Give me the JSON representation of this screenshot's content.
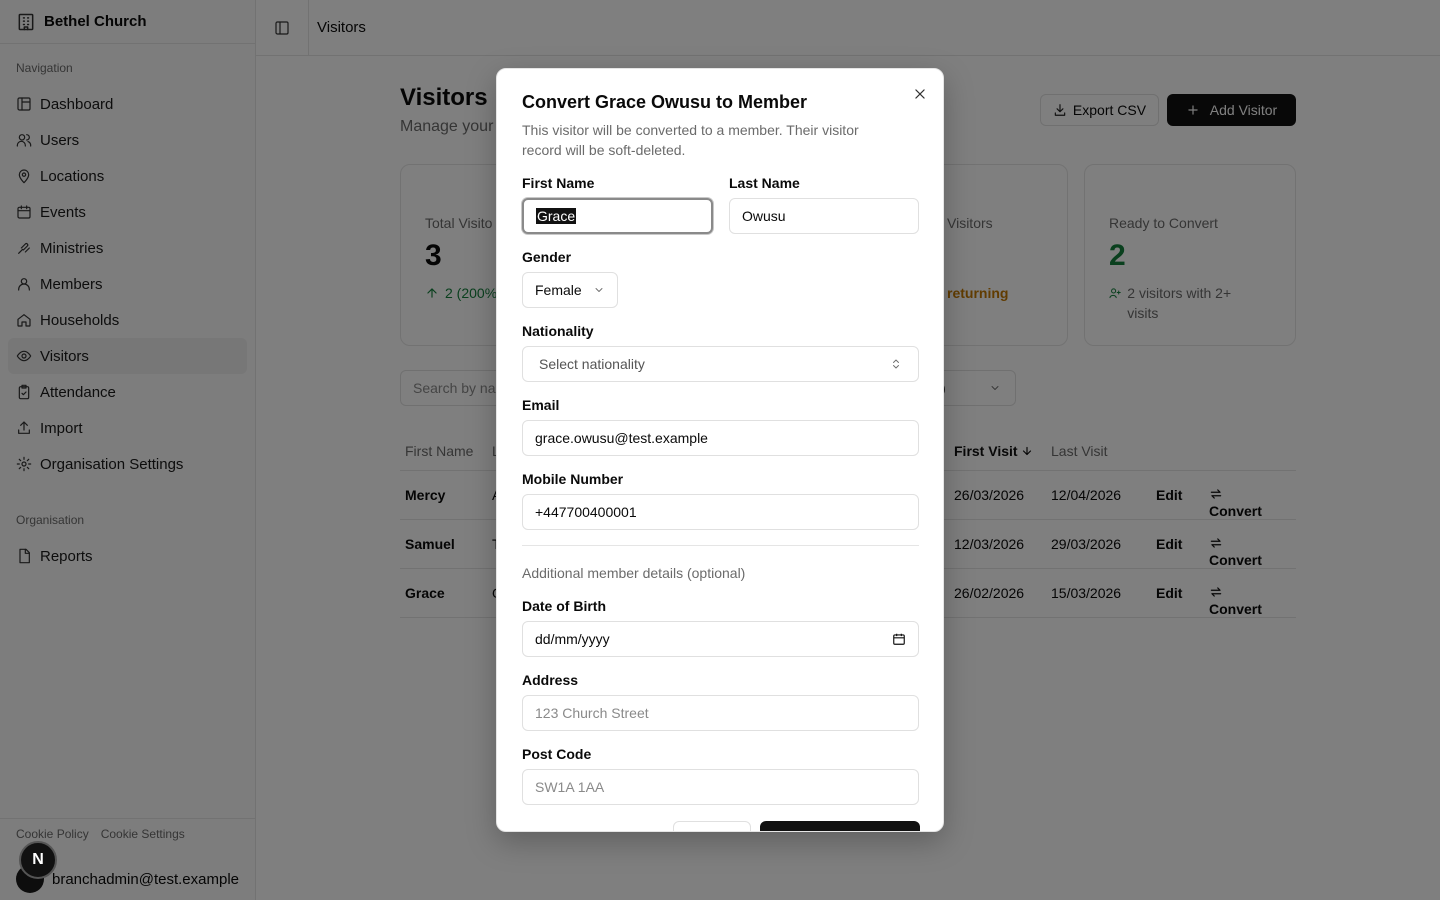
{
  "sidebar": {
    "org_name": "Bethel Church",
    "nav_group_label": "Navigation",
    "items": [
      {
        "label": "Dashboard",
        "icon": "dashboard-icon"
      },
      {
        "label": "Users",
        "icon": "users-icon"
      },
      {
        "label": "Locations",
        "icon": "map-pin-icon"
      },
      {
        "label": "Events",
        "icon": "calendar-icon"
      },
      {
        "label": "Ministries",
        "icon": "hands-icon"
      },
      {
        "label": "Members",
        "icon": "user-icon"
      },
      {
        "label": "Households",
        "icon": "home-icon"
      },
      {
        "label": "Visitors",
        "icon": "eye-icon",
        "active": true
      },
      {
        "label": "Attendance",
        "icon": "clipboard-icon"
      },
      {
        "label": "Import",
        "icon": "upload-icon"
      },
      {
        "label": "Organisation Settings",
        "icon": "gear-icon"
      }
    ],
    "org_group_label": "Organisation",
    "org_items": [
      {
        "label": "Reports",
        "icon": "file-icon"
      }
    ],
    "footer_links": [
      "Cookie Policy",
      "Cookie Settings"
    ],
    "user_email": "branchadmin@test.example",
    "next_badge": "N"
  },
  "topbar": {
    "title": "Visitors"
  },
  "page": {
    "title": "Visitors",
    "subtitle": "Manage your",
    "export_label": "Export CSV",
    "add_label": "Add Visitor",
    "search_placeholder": "Search by na",
    "filter_value": ")"
  },
  "stats": [
    {
      "label": "Total Visito",
      "value": "3",
      "note": "2 (200%)",
      "note_color": "#15803d"
    },
    {
      "label": "Visitors",
      "value": "",
      "note": "returning",
      "note_color": "#c27803"
    },
    {
      "label": "Ready to Convert",
      "value": "2",
      "note": "2 visitors with 2+ visits",
      "value_color": "#15803d"
    }
  ],
  "table": {
    "headers": {
      "first_name": "First Name",
      "last_name": "L",
      "first_visit": "First Visit",
      "last_visit": "Last Visit"
    },
    "rows": [
      {
        "first_name": "Mercy",
        "last_initial": "A",
        "first_visit": "26/03/2026",
        "last_visit": "12/04/2026"
      },
      {
        "first_name": "Samuel",
        "last_initial": "T",
        "first_visit": "12/03/2026",
        "last_visit": "29/03/2026"
      },
      {
        "first_name": "Grace",
        "last_initial": "O",
        "first_visit": "26/02/2026",
        "last_visit": "15/03/2026"
      }
    ],
    "edit_label": "Edit",
    "convert_label": "Convert"
  },
  "modal": {
    "title": "Convert Grace Owusu to Member",
    "description": "This visitor will be converted to a member. Their visitor record will be soft-deleted.",
    "first_name_label": "First Name",
    "first_name_value": "Grace",
    "last_name_label": "Last Name",
    "last_name_value": "Owusu",
    "gender_label": "Gender",
    "gender_value": "Female",
    "nationality_label": "Nationality",
    "nationality_placeholder": "Select nationality",
    "email_label": "Email",
    "email_value": "grace.owusu@test.example",
    "mobile_label": "Mobile Number",
    "mobile_value": "+447700400001",
    "additional_note": "Additional member details (optional)",
    "dob_label": "Date of Birth",
    "dob_placeholder": "dd/mm/yyyy",
    "address_label": "Address",
    "address_placeholder": "123 Church Street",
    "postcode_label": "Post Code",
    "postcode_placeholder": "SW1A 1AA"
  }
}
